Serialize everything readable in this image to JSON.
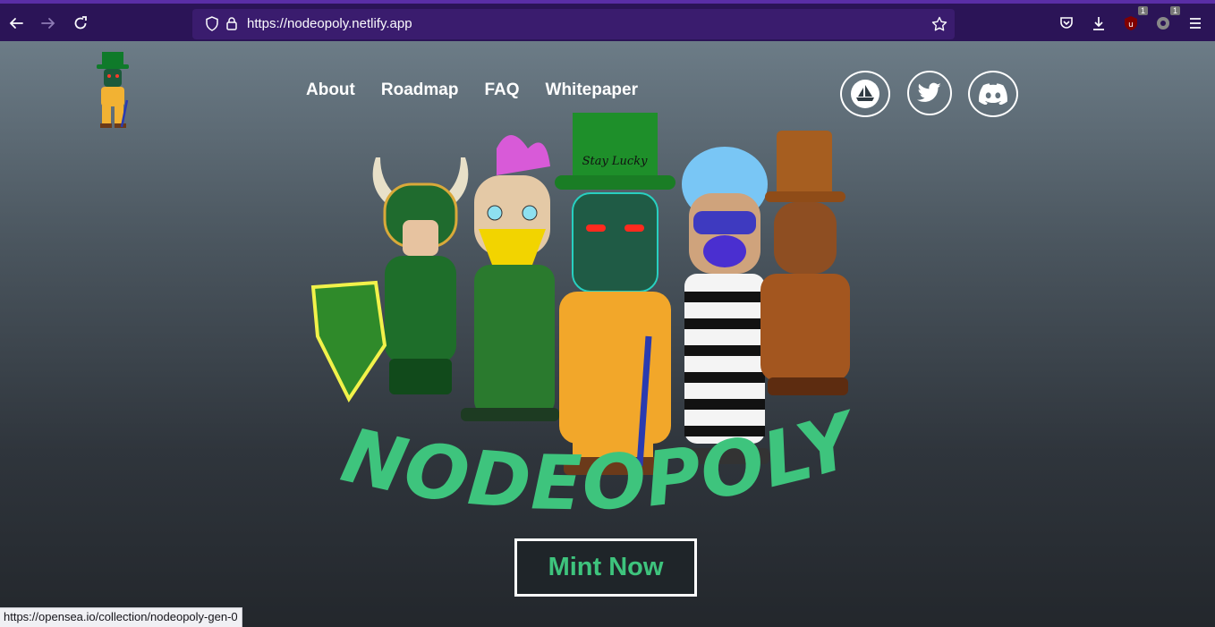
{
  "browser": {
    "url_display": "https://nodeopoly.netlify.app",
    "ext1_badge": "1",
    "ext2_badge": "1",
    "icons": [
      "back-icon",
      "forward-icon",
      "reload-icon",
      "shield-icon",
      "lock-icon",
      "bookmark-star-icon",
      "pocket-icon",
      "download-icon",
      "extension-icon",
      "menu-icon"
    ]
  },
  "nav": {
    "items": [
      {
        "label": "About"
      },
      {
        "label": "Roadmap"
      },
      {
        "label": "FAQ"
      },
      {
        "label": "Whitepaper"
      }
    ]
  },
  "social": [
    {
      "name": "opensea-icon"
    },
    {
      "name": "twitter-icon"
    },
    {
      "name": "discord-icon"
    }
  ],
  "hero": {
    "brand_text": "NODEOPOLY",
    "hat_text": "Stay Lucky",
    "mint_label": "Mint Now"
  },
  "colors": {
    "brand_green": "#3ec47d",
    "toolbar": "#2b1457",
    "urlbar": "#3a1c6e"
  },
  "status": {
    "link_preview": "https://opensea.io/collection/nodeopoly-gen-0"
  }
}
